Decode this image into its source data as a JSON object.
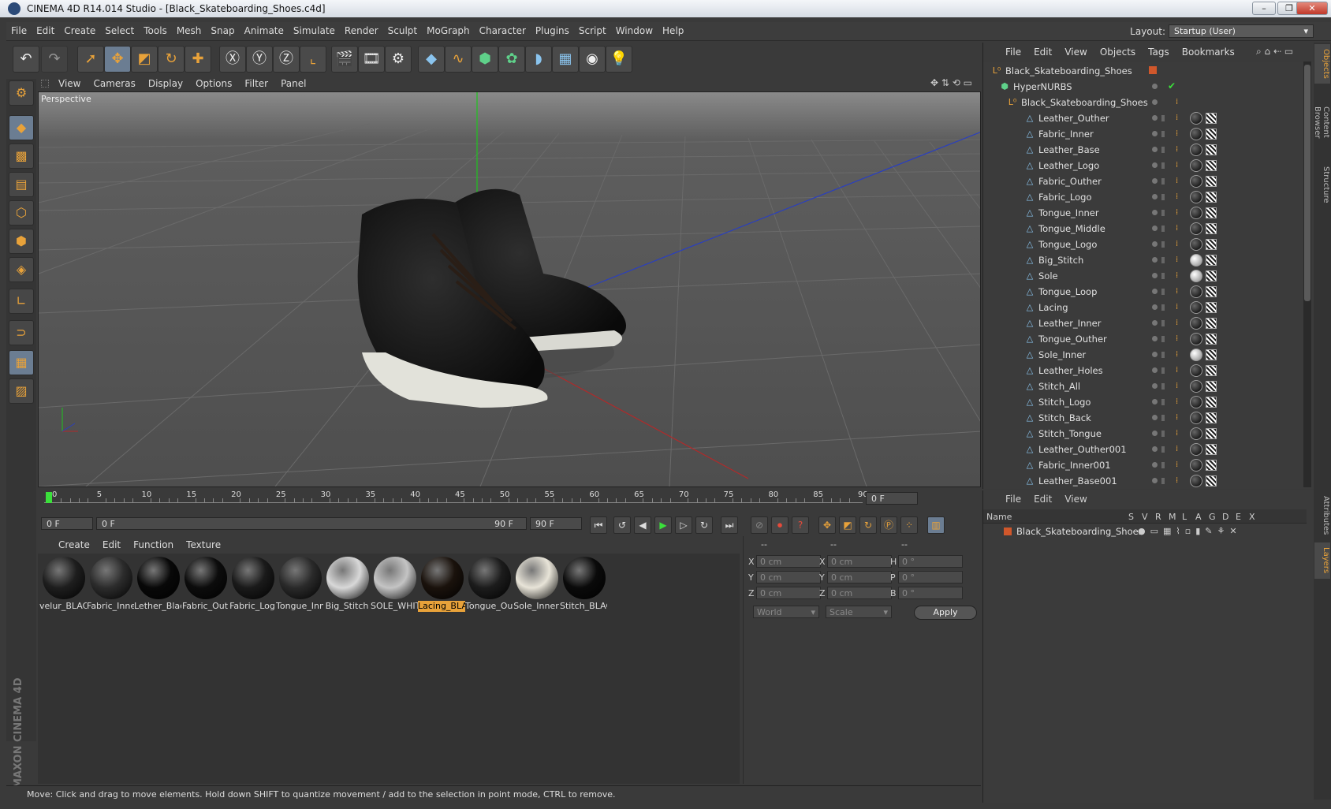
{
  "window": {
    "title": "CINEMA 4D R14.014 Studio - [Black_Skateboarding_Shoes.c4d]",
    "controls": [
      "minimize",
      "maximize",
      "close"
    ]
  },
  "menubar": {
    "items": [
      "File",
      "Edit",
      "Create",
      "Select",
      "Tools",
      "Mesh",
      "Snap",
      "Animate",
      "Simulate",
      "Render",
      "Sculpt",
      "MoGraph",
      "Character",
      "Plugins",
      "Script",
      "Window",
      "Help"
    ],
    "layout_label": "Layout:",
    "layout_value": "Startup (User)"
  },
  "viewport": {
    "menu": [
      "View",
      "Cameras",
      "Display",
      "Options",
      "Filter",
      "Panel"
    ],
    "label": "Perspective"
  },
  "timeline": {
    "ticks": [
      "0",
      "5",
      "10",
      "15",
      "20",
      "25",
      "30",
      "35",
      "40",
      "45",
      "50",
      "55",
      "60",
      "65",
      "70",
      "75",
      "80",
      "85",
      "90"
    ],
    "current": "0 F",
    "start": "0 F",
    "range_start": "0 F",
    "range_end": "90 F",
    "end": "90 F"
  },
  "materials": {
    "menu": [
      "Create",
      "Edit",
      "Function",
      "Texture"
    ],
    "items": [
      {
        "name": "velur_BLAC",
        "color": "#1e1e1e"
      },
      {
        "name": "Fabric_Inne",
        "color": "#2c2c2c"
      },
      {
        "name": "Lether_Blac",
        "color": "#080808"
      },
      {
        "name": "Fabric_Out",
        "color": "#0c0c0c"
      },
      {
        "name": "Fabric_Log",
        "color": "#1a1a1a"
      },
      {
        "name": "Tongue_Inn",
        "color": "#2a2a2a"
      },
      {
        "name": "Big_Stitch",
        "color": "#d8d8d8"
      },
      {
        "name": "SOLE_WHIT",
        "color": "#c4c4c4"
      },
      {
        "name": "Lacing_BLA",
        "color": "#1a120c"
      },
      {
        "name": "Tongue_Ou",
        "color": "#1c1c1c"
      },
      {
        "name": "Sole_Inner",
        "color": "#e8e4d8"
      },
      {
        "name": "Stitch_BLAC",
        "color": "#0a0a0a"
      }
    ],
    "selected_index": 8
  },
  "coords": {
    "headers": [
      "--",
      "--",
      "--"
    ],
    "rows": [
      {
        "a": "X",
        "av": "0 cm",
        "b": "X",
        "bv": "0 cm",
        "c": "H",
        "cv": "0 °"
      },
      {
        "a": "Y",
        "av": "0 cm",
        "b": "Y",
        "bv": "0 cm",
        "c": "P",
        "cv": "0 °"
      },
      {
        "a": "Z",
        "av": "0 cm",
        "b": "Z",
        "bv": "0 cm",
        "c": "B",
        "cv": "0 °"
      }
    ],
    "space": "World",
    "mode": "Scale",
    "apply": "Apply"
  },
  "objects": {
    "menu": [
      "File",
      "Edit",
      "View",
      "Objects",
      "Tags",
      "Bookmarks"
    ],
    "root": "Black_Skateboarding_Shoes",
    "nurbs": "HyperNURBS",
    "group": "Black_Skateboarding_Shoes",
    "items": [
      {
        "name": "Leather_Outher",
        "mat": "dark"
      },
      {
        "name": "Fabric_Inner",
        "mat": "dark"
      },
      {
        "name": "Leather_Base",
        "mat": "dark"
      },
      {
        "name": "Leather_Logo",
        "mat": "dark"
      },
      {
        "name": "Fabric_Outher",
        "mat": "dark"
      },
      {
        "name": "Fabric_Logo",
        "mat": "dark"
      },
      {
        "name": "Tongue_Inner",
        "mat": "dark"
      },
      {
        "name": "Tongue_Middle",
        "mat": "dark"
      },
      {
        "name": "Tongue_Logo",
        "mat": "dark"
      },
      {
        "name": "Big_Stitch",
        "mat": "light"
      },
      {
        "name": "Sole",
        "mat": "light"
      },
      {
        "name": "Tongue_Loop",
        "mat": "dark"
      },
      {
        "name": "Lacing",
        "mat": "dark"
      },
      {
        "name": "Leather_Inner",
        "mat": "dark"
      },
      {
        "name": "Tongue_Outher",
        "mat": "dark"
      },
      {
        "name": "Sole_Inner",
        "mat": "light"
      },
      {
        "name": "Leather_Holes",
        "mat": "dark"
      },
      {
        "name": "Stitch_All",
        "mat": "dark"
      },
      {
        "name": "Stitch_Logo",
        "mat": "dark"
      },
      {
        "name": "Stitch_Back",
        "mat": "dark"
      },
      {
        "name": "Stitch_Tongue",
        "mat": "dark"
      },
      {
        "name": "Leather_Outher001",
        "mat": "dark"
      },
      {
        "name": "Fabric_Inner001",
        "mat": "dark"
      },
      {
        "name": "Leather_Base001",
        "mat": "dark"
      }
    ]
  },
  "layers": {
    "menu": [
      "File",
      "Edit",
      "View"
    ],
    "columns": [
      "Name",
      "S",
      "V",
      "R",
      "M",
      "L",
      "A",
      "G",
      "D",
      "E",
      "X"
    ],
    "rows": [
      "Black_Skateboarding_Shoes"
    ]
  },
  "side_tabs": [
    "Objects",
    "Content Browser",
    "Structure",
    "Attributes",
    "Layers"
  ],
  "status": "Move: Click and drag to move elements. Hold down SHIFT to quantize movement / add to the selection in point mode, CTRL to remove.",
  "brand": "MAXON CINEMA 4D",
  "colors": {
    "accent": "#e8a23a",
    "selection": "#6b7d92",
    "background": "#3a3a3a"
  }
}
